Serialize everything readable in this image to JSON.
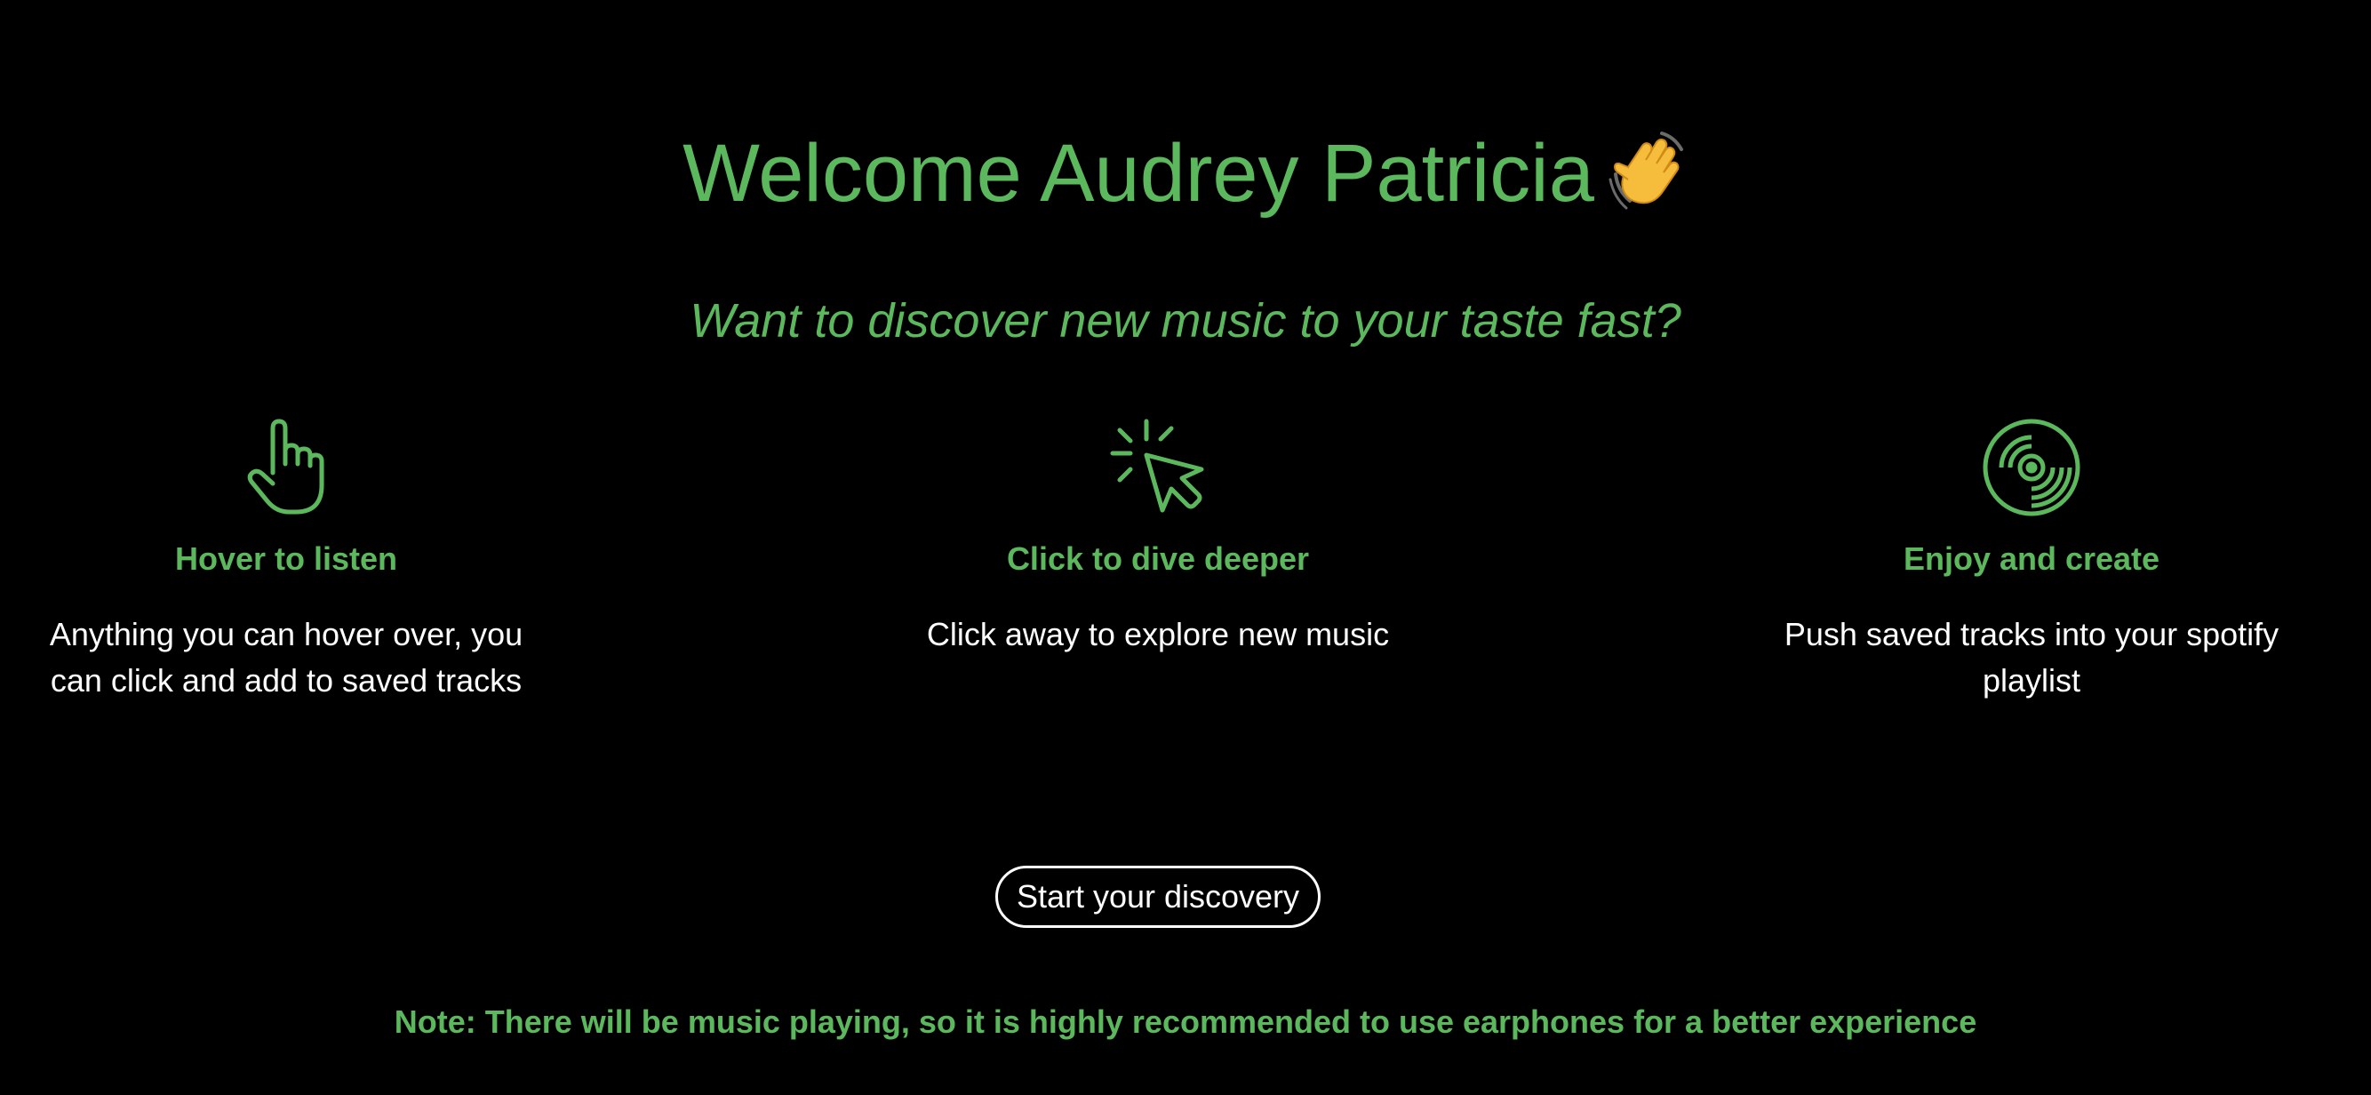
{
  "welcome": {
    "greeting": "Welcome",
    "name": "Audrey Patricia",
    "emoji_icon": "waving-hand-icon"
  },
  "subtitle": "Want to discover new music to your taste fast?",
  "features": [
    {
      "icon": "pointing-hand-icon",
      "title": "Hover to listen",
      "description": "Anything you can hover over, you can click and add to saved tracks"
    },
    {
      "icon": "cursor-click-icon",
      "title": "Click to dive deeper",
      "description": "Click away to explore new music"
    },
    {
      "icon": "vinyl-record-icon",
      "title": "Enjoy and create",
      "description": "Push saved tracks into your spotify playlist"
    }
  ],
  "cta_label": "Start your discovery",
  "note": "Note: There will be music playing, so it is highly recommended to use earphones for a better experience",
  "colors": {
    "accent": "#5cb85c",
    "background": "#000000",
    "text": "#ffffff"
  }
}
